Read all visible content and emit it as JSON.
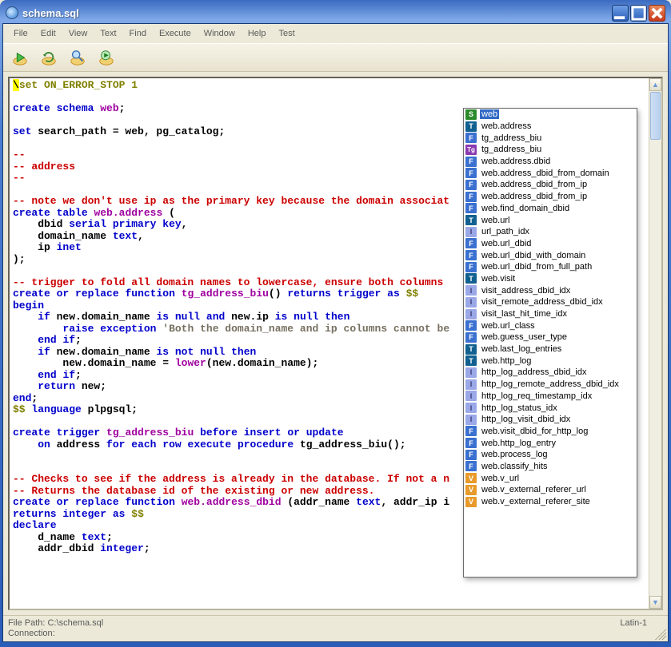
{
  "window": {
    "title": "schema.sql"
  },
  "menu": [
    "File",
    "Edit",
    "View",
    "Text",
    "Find",
    "Execute",
    "Window",
    "Help",
    "Test"
  ],
  "code": {
    "l1a": "set",
    "l1b": " ON_ERROR_STOP 1",
    "l3a": "create",
    "l3b": "schema",
    "l3c": "web",
    "l5a": "set",
    "l5b": " search_path = web, pg_catalog;",
    "l7": "--",
    "l8": "-- address",
    "l9": "--",
    "l11": "-- note we don't use ip as the primary key because the domain associat",
    "l12a": "create",
    "l12b": "table",
    "l12c": "web.address",
    "l12d": " (",
    "l13a": "    dbid ",
    "l13b": "serial",
    "l13c": "primary",
    "l13d": "key",
    "l14a": "    domain_name ",
    "l14b": "text",
    "l15a": "    ip ",
    "l15b": "inet",
    "l16": ");",
    "l18": "-- trigger to fold all domain names to lowercase, ensure both columns",
    "l19a": "create",
    "l19b": "or",
    "l19c": "replace",
    "l19d": "function",
    "l19e": "tg_address_biu",
    "l19f": "() ",
    "l19g": "returns",
    "l19h": "trigger",
    "l19i": "as",
    "l19j": "$$",
    "l20": "begin",
    "l21a": "    ",
    "l21b": "if",
    "l21c": " new.domain_name ",
    "l21d": "is",
    "l21e": "null",
    "l21f": "and",
    "l21g": " new.ip ",
    "l21h": "is",
    "l21i": "null",
    "l21j": "then",
    "l22a": "        ",
    "l22b": "raise",
    "l22c": "exception",
    "l22d": "'Both the domain_name and ip columns cannot be",
    "l23a": "    ",
    "l23b": "end",
    "l23c": "if",
    "l24a": "    ",
    "l24b": "if",
    "l24c": " new.domain_name ",
    "l24d": "is",
    "l24e": "not",
    "l24f": "null",
    "l24g": "then",
    "l25a": "        new.domain_name = ",
    "l25b": "lower",
    "l25c": "(new.domain_name);",
    "l26a": "    ",
    "l26b": "end",
    "l26c": "if",
    "l27a": "    ",
    "l27b": "return",
    "l27c": " new;",
    "l28a": "end",
    "l28b": ";",
    "l29a": "$$",
    "l29b": "language",
    "l29c": " plpgsql;",
    "l31a": "create",
    "l31b": "trigger",
    "l31c": "tg_address_biu",
    "l31d": "before",
    "l31e": "insert",
    "l31f": "or",
    "l31g": "update",
    "l32a": "    ",
    "l32b": "on",
    "l32c": " address ",
    "l32d": "for",
    "l32e": "each",
    "l32f": "row",
    "l32g": "execute",
    "l32h": "procedure",
    "l32i": " tg_address_biu();",
    "l35": "-- Checks to see if the address is already in the database. If not a n",
    "l36": "-- Returns the database id of the existing or new address.",
    "l37a": "create",
    "l37b": "or",
    "l37c": "replace",
    "l37d": "function",
    "l37e": "web.address_dbid",
    "l37f": " (addr_name ",
    "l37g": "text",
    "l37h": ", addr_ip i",
    "l38a": "returns",
    "l38b": "integer",
    "l38c": "as",
    "l38d": "$$",
    "l39": "declare",
    "l40a": "    d_name ",
    "l40b": "text",
    "l41a": "    addr_dbid ",
    "l41b": "integer"
  },
  "autocomplete": [
    {
      "icon": "S",
      "label": "web",
      "selected": true
    },
    {
      "icon": "T",
      "label": "web.address"
    },
    {
      "icon": "F",
      "label": "tg_address_biu"
    },
    {
      "icon": "Tg",
      "label": "tg_address_biu"
    },
    {
      "icon": "F",
      "label": "web.address.dbid"
    },
    {
      "icon": "F",
      "label": "web.address_dbid_from_domain"
    },
    {
      "icon": "F",
      "label": "web.address_dbid_from_ip"
    },
    {
      "icon": "F",
      "label": "web.address_dbid_from_ip"
    },
    {
      "icon": "F",
      "label": "web.find_domain_dbid"
    },
    {
      "icon": "T",
      "label": "web.url"
    },
    {
      "icon": "I",
      "label": "url_path_idx"
    },
    {
      "icon": "F",
      "label": "web.url_dbid"
    },
    {
      "icon": "F",
      "label": "web.url_dbid_with_domain"
    },
    {
      "icon": "F",
      "label": "web.url_dbid_from_full_path"
    },
    {
      "icon": "T",
      "label": "web.visit"
    },
    {
      "icon": "I",
      "label": "visit_address_dbid_idx"
    },
    {
      "icon": "I",
      "label": "visit_remote_address_dbid_idx"
    },
    {
      "icon": "I",
      "label": "visit_last_hit_time_idx"
    },
    {
      "icon": "F",
      "label": "web.url_class"
    },
    {
      "icon": "F",
      "label": "web.guess_user_type"
    },
    {
      "icon": "T",
      "label": "web.last_log_entries"
    },
    {
      "icon": "T",
      "label": "web.http_log"
    },
    {
      "icon": "I",
      "label": "http_log_address_dbid_idx"
    },
    {
      "icon": "I",
      "label": "http_log_remote_address_dbid_idx"
    },
    {
      "icon": "I",
      "label": "http_log_req_timestamp_idx"
    },
    {
      "icon": "I",
      "label": "http_log_status_idx"
    },
    {
      "icon": "I",
      "label": "http_log_visit_dbid_idx"
    },
    {
      "icon": "F",
      "label": "web.visit_dbid_for_http_log"
    },
    {
      "icon": "F",
      "label": "web.http_log_entry"
    },
    {
      "icon": "F",
      "label": "web.process_log"
    },
    {
      "icon": "F",
      "label": "web.classify_hits"
    },
    {
      "icon": "V",
      "label": "web.v_url"
    },
    {
      "icon": "V",
      "label": "web.v_external_referer_url"
    },
    {
      "icon": "V",
      "label": "web.v_external_referer_site"
    }
  ],
  "status": {
    "filepath_label": "File Path: ",
    "filepath_value": "C:\\schema.sql",
    "connection_label": "Connection:",
    "encoding": "Latin-1"
  }
}
